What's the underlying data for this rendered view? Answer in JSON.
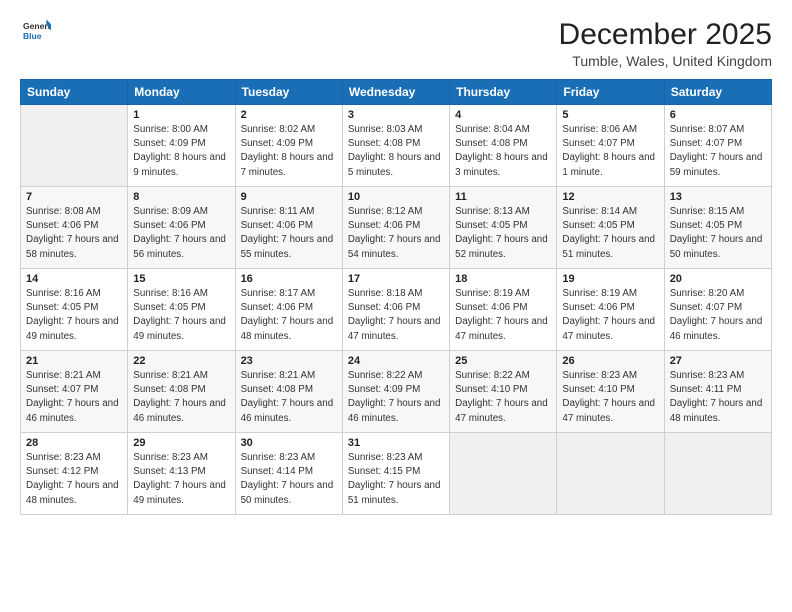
{
  "header": {
    "logo_general": "General",
    "logo_blue": "Blue",
    "title": "December 2025",
    "subtitle": "Tumble, Wales, United Kingdom"
  },
  "days_of_week": [
    "Sunday",
    "Monday",
    "Tuesday",
    "Wednesday",
    "Thursday",
    "Friday",
    "Saturday"
  ],
  "weeks": [
    [
      {
        "day": "",
        "sunrise": "",
        "sunset": "",
        "daylight": ""
      },
      {
        "day": "1",
        "sunrise": "Sunrise: 8:00 AM",
        "sunset": "Sunset: 4:09 PM",
        "daylight": "Daylight: 8 hours and 9 minutes."
      },
      {
        "day": "2",
        "sunrise": "Sunrise: 8:02 AM",
        "sunset": "Sunset: 4:09 PM",
        "daylight": "Daylight: 8 hours and 7 minutes."
      },
      {
        "day": "3",
        "sunrise": "Sunrise: 8:03 AM",
        "sunset": "Sunset: 4:08 PM",
        "daylight": "Daylight: 8 hours and 5 minutes."
      },
      {
        "day": "4",
        "sunrise": "Sunrise: 8:04 AM",
        "sunset": "Sunset: 4:08 PM",
        "daylight": "Daylight: 8 hours and 3 minutes."
      },
      {
        "day": "5",
        "sunrise": "Sunrise: 8:06 AM",
        "sunset": "Sunset: 4:07 PM",
        "daylight": "Daylight: 8 hours and 1 minute."
      },
      {
        "day": "6",
        "sunrise": "Sunrise: 8:07 AM",
        "sunset": "Sunset: 4:07 PM",
        "daylight": "Daylight: 7 hours and 59 minutes."
      }
    ],
    [
      {
        "day": "7",
        "sunrise": "Sunrise: 8:08 AM",
        "sunset": "Sunset: 4:06 PM",
        "daylight": "Daylight: 7 hours and 58 minutes."
      },
      {
        "day": "8",
        "sunrise": "Sunrise: 8:09 AM",
        "sunset": "Sunset: 4:06 PM",
        "daylight": "Daylight: 7 hours and 56 minutes."
      },
      {
        "day": "9",
        "sunrise": "Sunrise: 8:11 AM",
        "sunset": "Sunset: 4:06 PM",
        "daylight": "Daylight: 7 hours and 55 minutes."
      },
      {
        "day": "10",
        "sunrise": "Sunrise: 8:12 AM",
        "sunset": "Sunset: 4:06 PM",
        "daylight": "Daylight: 7 hours and 54 minutes."
      },
      {
        "day": "11",
        "sunrise": "Sunrise: 8:13 AM",
        "sunset": "Sunset: 4:05 PM",
        "daylight": "Daylight: 7 hours and 52 minutes."
      },
      {
        "day": "12",
        "sunrise": "Sunrise: 8:14 AM",
        "sunset": "Sunset: 4:05 PM",
        "daylight": "Daylight: 7 hours and 51 minutes."
      },
      {
        "day": "13",
        "sunrise": "Sunrise: 8:15 AM",
        "sunset": "Sunset: 4:05 PM",
        "daylight": "Daylight: 7 hours and 50 minutes."
      }
    ],
    [
      {
        "day": "14",
        "sunrise": "Sunrise: 8:16 AM",
        "sunset": "Sunset: 4:05 PM",
        "daylight": "Daylight: 7 hours and 49 minutes."
      },
      {
        "day": "15",
        "sunrise": "Sunrise: 8:16 AM",
        "sunset": "Sunset: 4:05 PM",
        "daylight": "Daylight: 7 hours and 49 minutes."
      },
      {
        "day": "16",
        "sunrise": "Sunrise: 8:17 AM",
        "sunset": "Sunset: 4:06 PM",
        "daylight": "Daylight: 7 hours and 48 minutes."
      },
      {
        "day": "17",
        "sunrise": "Sunrise: 8:18 AM",
        "sunset": "Sunset: 4:06 PM",
        "daylight": "Daylight: 7 hours and 47 minutes."
      },
      {
        "day": "18",
        "sunrise": "Sunrise: 8:19 AM",
        "sunset": "Sunset: 4:06 PM",
        "daylight": "Daylight: 7 hours and 47 minutes."
      },
      {
        "day": "19",
        "sunrise": "Sunrise: 8:19 AM",
        "sunset": "Sunset: 4:06 PM",
        "daylight": "Daylight: 7 hours and 47 minutes."
      },
      {
        "day": "20",
        "sunrise": "Sunrise: 8:20 AM",
        "sunset": "Sunset: 4:07 PM",
        "daylight": "Daylight: 7 hours and 46 minutes."
      }
    ],
    [
      {
        "day": "21",
        "sunrise": "Sunrise: 8:21 AM",
        "sunset": "Sunset: 4:07 PM",
        "daylight": "Daylight: 7 hours and 46 minutes."
      },
      {
        "day": "22",
        "sunrise": "Sunrise: 8:21 AM",
        "sunset": "Sunset: 4:08 PM",
        "daylight": "Daylight: 7 hours and 46 minutes."
      },
      {
        "day": "23",
        "sunrise": "Sunrise: 8:21 AM",
        "sunset": "Sunset: 4:08 PM",
        "daylight": "Daylight: 7 hours and 46 minutes."
      },
      {
        "day": "24",
        "sunrise": "Sunrise: 8:22 AM",
        "sunset": "Sunset: 4:09 PM",
        "daylight": "Daylight: 7 hours and 46 minutes."
      },
      {
        "day": "25",
        "sunrise": "Sunrise: 8:22 AM",
        "sunset": "Sunset: 4:10 PM",
        "daylight": "Daylight: 7 hours and 47 minutes."
      },
      {
        "day": "26",
        "sunrise": "Sunrise: 8:23 AM",
        "sunset": "Sunset: 4:10 PM",
        "daylight": "Daylight: 7 hours and 47 minutes."
      },
      {
        "day": "27",
        "sunrise": "Sunrise: 8:23 AM",
        "sunset": "Sunset: 4:11 PM",
        "daylight": "Daylight: 7 hours and 48 minutes."
      }
    ],
    [
      {
        "day": "28",
        "sunrise": "Sunrise: 8:23 AM",
        "sunset": "Sunset: 4:12 PM",
        "daylight": "Daylight: 7 hours and 48 minutes."
      },
      {
        "day": "29",
        "sunrise": "Sunrise: 8:23 AM",
        "sunset": "Sunset: 4:13 PM",
        "daylight": "Daylight: 7 hours and 49 minutes."
      },
      {
        "day": "30",
        "sunrise": "Sunrise: 8:23 AM",
        "sunset": "Sunset: 4:14 PM",
        "daylight": "Daylight: 7 hours and 50 minutes."
      },
      {
        "day": "31",
        "sunrise": "Sunrise: 8:23 AM",
        "sunset": "Sunset: 4:15 PM",
        "daylight": "Daylight: 7 hours and 51 minutes."
      },
      {
        "day": "",
        "sunrise": "",
        "sunset": "",
        "daylight": ""
      },
      {
        "day": "",
        "sunrise": "",
        "sunset": "",
        "daylight": ""
      },
      {
        "day": "",
        "sunrise": "",
        "sunset": "",
        "daylight": ""
      }
    ]
  ]
}
